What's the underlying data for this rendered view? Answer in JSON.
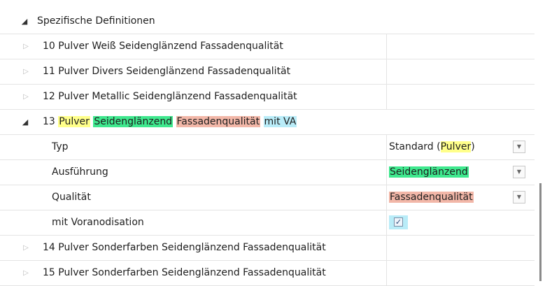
{
  "tree": {
    "root_label": "Spezifische Definitionen",
    "items": [
      {
        "label": "10 Pulver Weiß Seidenglänzend Fassadenqualität"
      },
      {
        "label": "11 Pulver Divers Seidenglänzend Fassadenqualität"
      },
      {
        "label": "12 Pulver Metallic Seidenglänzend Fassadenqualität"
      }
    ],
    "expanded": {
      "num": "13",
      "w1": "Pulver",
      "w2": "Seidenglänzend",
      "w3": "Fassadenqualität",
      "w4": "mit VA"
    },
    "props": {
      "typ_label": "Typ",
      "typ_value_prefix": "Standard (",
      "typ_value_hl": "Pulver",
      "typ_value_suffix": ")",
      "ausf_label": "Ausführung",
      "ausf_value": "Seidenglänzend",
      "qual_label": "Qualität",
      "qual_value": "Fassadenqualität",
      "vor_label": "mit Voranodisation",
      "vor_checked": true,
      "checkmark": "✓"
    },
    "items_after": [
      {
        "label": "14 Pulver Sonderfarben Seidenglänzend Fassadenqualität"
      },
      {
        "label": "15 Pulver Sonderfarben Seidenglänzend Fassadenqualität"
      }
    ]
  },
  "icons": {
    "expanded_arrow": "◢",
    "collapsed_arrow": "▷",
    "dropdown": "▼"
  },
  "colors": {
    "highlight_yellow": "#ffff8a",
    "highlight_green": "#3fe88e",
    "highlight_red": "#f2b7a8",
    "highlight_blue": "#b9ecf8"
  }
}
